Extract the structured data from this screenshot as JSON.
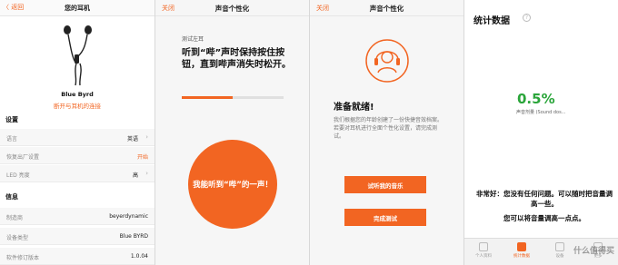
{
  "panel1": {
    "back_label": "〈 返回",
    "title": "您的耳机",
    "device_name": "Blue Byrd",
    "disconnect_label": "断开与耳机的连接",
    "settings_heading": "设置",
    "settings": [
      {
        "label": "语言",
        "value": "英语"
      },
      {
        "label": "恢复出厂设置",
        "value": "开始"
      },
      {
        "label": "LED 亮度",
        "value": "高"
      }
    ],
    "info_heading": "信息",
    "info": [
      {
        "label": "制造商",
        "value": "beyerdynamic"
      },
      {
        "label": "设备类型",
        "value": "Blue BYRD"
      },
      {
        "label": "软件修订版本",
        "value": "1.0.04"
      }
    ]
  },
  "panel2": {
    "close_label": "关闭",
    "title": "声音个性化",
    "test_ear": "测试左耳",
    "instruction": "听到“哔”声时保持按住按钮，直到哔声消失时松开。",
    "progress": 0.5,
    "big_button": "我能听到“哔”的一声！"
  },
  "panel3": {
    "close_label": "关闭",
    "title": "声音个性化",
    "ready": "准备就绪!",
    "description": "我们根据您的年龄创建了一份快捷音效档案。若要对耳机进行全面个性化设置，请完成测试。",
    "try_button": "试听我的音乐",
    "complete_button": "完成测试"
  },
  "panel4": {
    "heading": "统计数据",
    "help": "?",
    "percent": "0.5%",
    "percent_caption": "声音剂量 (Sound dos...",
    "warning1": "非常好：您没有任何问题。可以随时把音量调高一些。",
    "warning2": "您可以将音量调高一点点。",
    "tabs": [
      "个人资料",
      "统计数据",
      "设备",
      "更多"
    ],
    "active_tab": 1,
    "watermark": "什么值得买"
  },
  "colors": {
    "accent": "#f26522",
    "good": "#2aa53a"
  }
}
